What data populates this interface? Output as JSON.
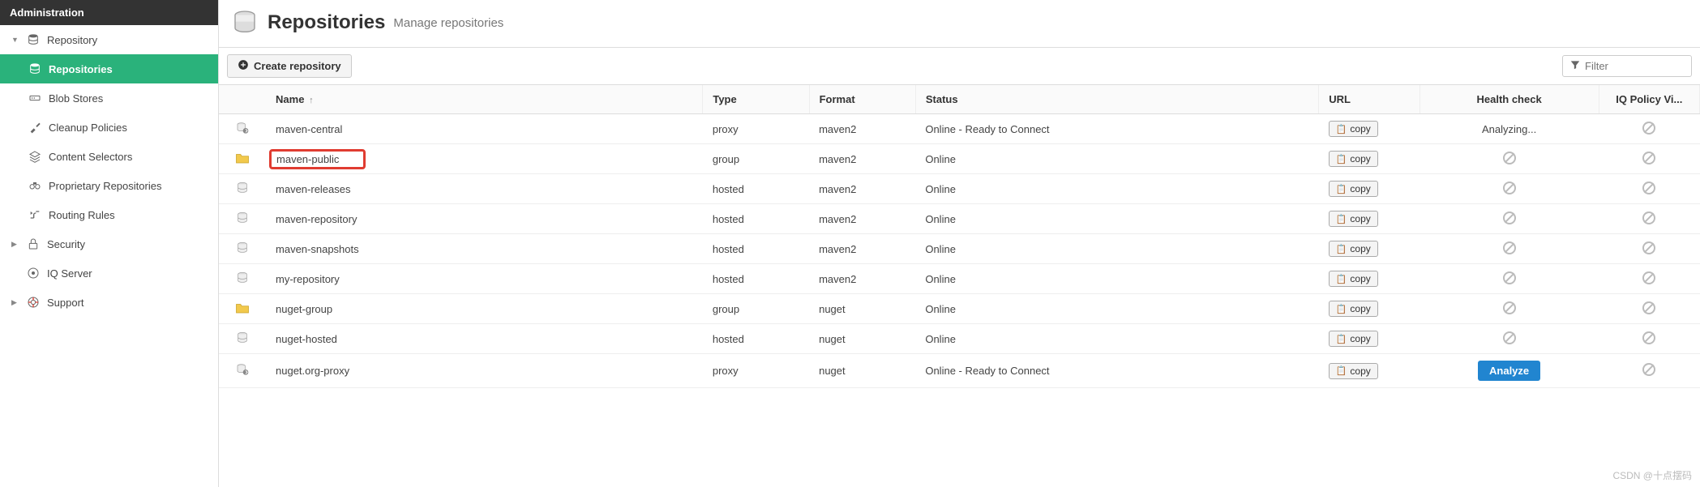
{
  "sidebar": {
    "header": "Administration",
    "items": [
      {
        "label": "Repository",
        "level": 1,
        "expanded": true,
        "icon": "db"
      },
      {
        "label": "Repositories",
        "level": 2,
        "active": true,
        "icon": "db"
      },
      {
        "label": "Blob Stores",
        "level": 2,
        "icon": "hdd"
      },
      {
        "label": "Cleanup Policies",
        "level": 2,
        "icon": "brush"
      },
      {
        "label": "Content Selectors",
        "level": 2,
        "icon": "layers"
      },
      {
        "label": "Proprietary Repositories",
        "level": 2,
        "icon": "binoc"
      },
      {
        "label": "Routing Rules",
        "level": 2,
        "icon": "route"
      },
      {
        "label": "Security",
        "level": 1,
        "expanded": false,
        "icon": "lock"
      },
      {
        "label": "IQ Server",
        "level": 1,
        "icon": "iq"
      },
      {
        "label": "Support",
        "level": 1,
        "expanded": false,
        "icon": "life"
      }
    ]
  },
  "header": {
    "title": "Repositories",
    "subtitle": "Manage repositories"
  },
  "toolbar": {
    "create_label": "Create repository",
    "filter_placeholder": "Filter"
  },
  "table": {
    "columns": {
      "name": "Name",
      "type": "Type",
      "format": "Format",
      "status": "Status",
      "url": "URL",
      "health": "Health check",
      "iq": "IQ Policy Vi..."
    },
    "sort_indicator": "↑",
    "copy_label": "copy",
    "analyze_label": "Analyze",
    "analyzing_label": "Analyzing...",
    "rows": [
      {
        "icon": "proxy",
        "name": "maven-central",
        "type": "proxy",
        "format": "maven2",
        "status": "Online - Ready to Connect",
        "health": "analyzing",
        "iq": "forbidden"
      },
      {
        "icon": "group",
        "name": "maven-public",
        "type": "group",
        "format": "maven2",
        "status": "Online",
        "health": "forbidden",
        "iq": "forbidden",
        "highlight": true
      },
      {
        "icon": "hosted",
        "name": "maven-releases",
        "type": "hosted",
        "format": "maven2",
        "status": "Online",
        "health": "forbidden",
        "iq": "forbidden"
      },
      {
        "icon": "hosted",
        "name": "maven-repository",
        "type": "hosted",
        "format": "maven2",
        "status": "Online",
        "health": "forbidden",
        "iq": "forbidden"
      },
      {
        "icon": "hosted",
        "name": "maven-snapshots",
        "type": "hosted",
        "format": "maven2",
        "status": "Online",
        "health": "forbidden",
        "iq": "forbidden"
      },
      {
        "icon": "hosted",
        "name": "my-repository",
        "type": "hosted",
        "format": "maven2",
        "status": "Online",
        "health": "forbidden",
        "iq": "forbidden"
      },
      {
        "icon": "group",
        "name": "nuget-group",
        "type": "group",
        "format": "nuget",
        "status": "Online",
        "health": "forbidden",
        "iq": "forbidden"
      },
      {
        "icon": "hosted",
        "name": "nuget-hosted",
        "type": "hosted",
        "format": "nuget",
        "status": "Online",
        "health": "forbidden",
        "iq": "forbidden"
      },
      {
        "icon": "proxy",
        "name": "nuget.org-proxy",
        "type": "proxy",
        "format": "nuget",
        "status": "Online - Ready to Connect",
        "health": "analyze_btn",
        "iq": "forbidden"
      }
    ]
  },
  "watermark": "CSDN @十点摆码"
}
